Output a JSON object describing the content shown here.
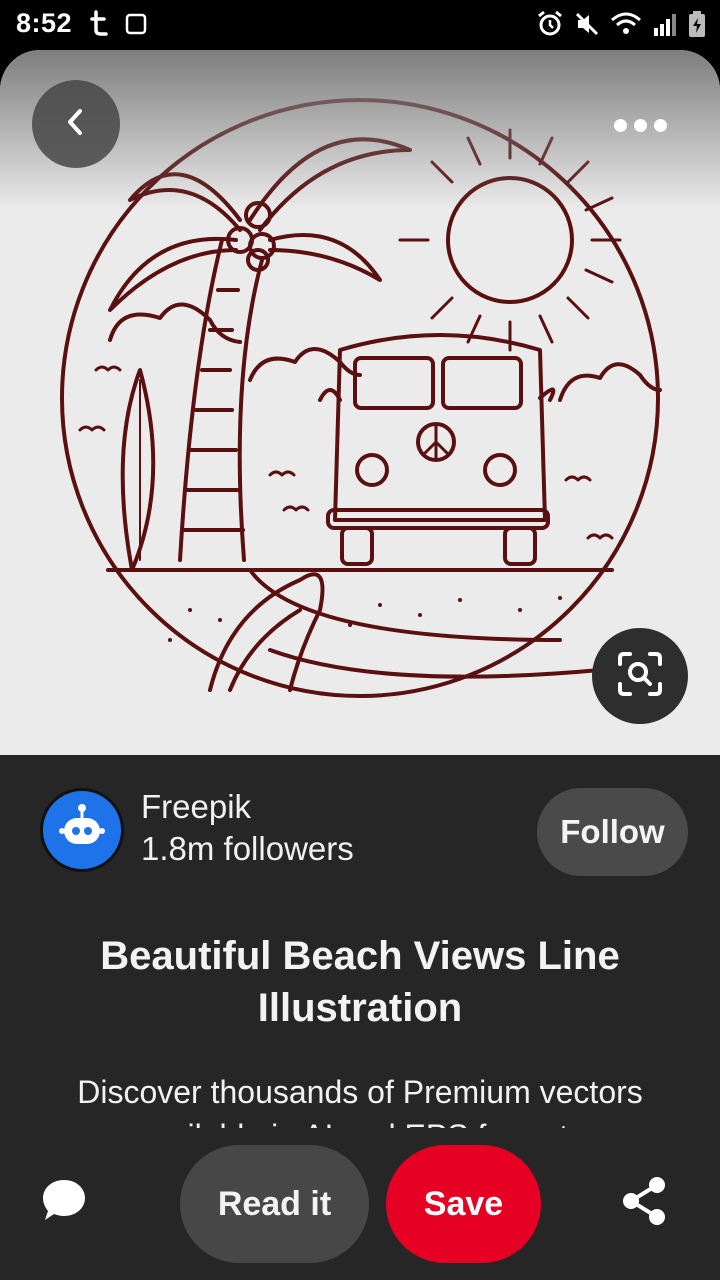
{
  "status_bar": {
    "time": "8:52",
    "icons": [
      "tumblr-icon",
      "square-icon",
      "alarm-icon",
      "mute-icon",
      "wifi-icon",
      "signal-icon",
      "battery-charging-icon"
    ]
  },
  "pin": {
    "image_alt": "beach line illustration with palm tree, van, sun and wave",
    "line_color": "#5a1010"
  },
  "creator": {
    "name": "Freepik",
    "followers": "1.8m followers",
    "follow_label": "Follow"
  },
  "title": "Beautiful Beach Views Line Illustration",
  "description": "Discover thousands of Premium vectors available in AI and EPS formats",
  "actions": {
    "read_label": "Read it",
    "save_label": "Save"
  },
  "colors": {
    "save": "#e60023",
    "card_bg": "#262626",
    "avatar": "#1e73e8"
  }
}
